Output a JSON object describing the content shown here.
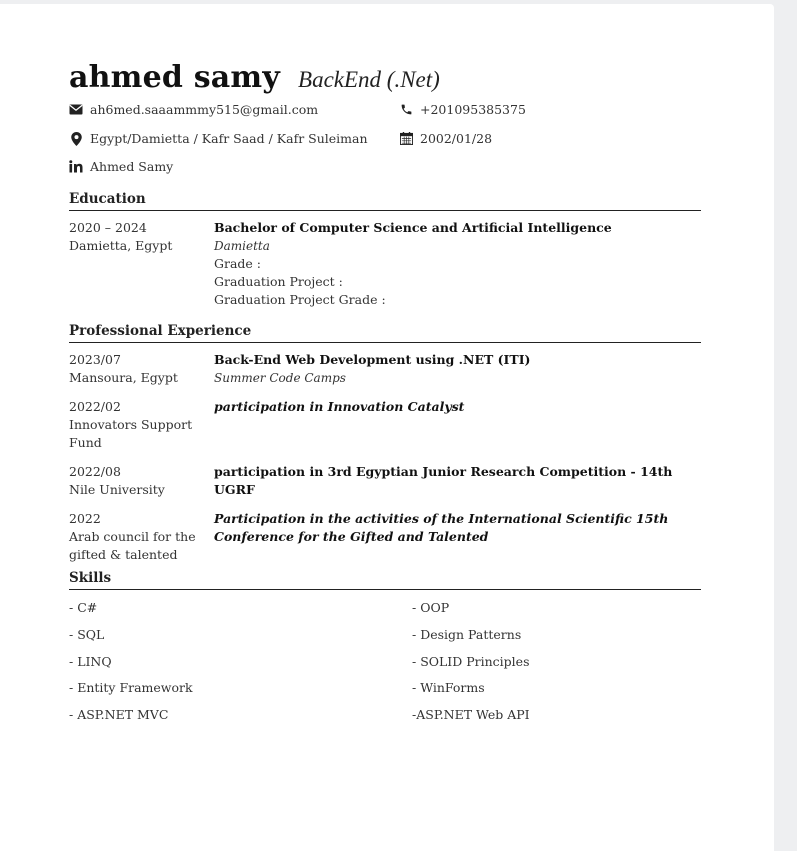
{
  "header": {
    "name": "ahmed samy",
    "role": "BackEnd (.Net)"
  },
  "contacts": {
    "email": "ah6med.saaammmy515@gmail.com",
    "phone": "+201095385375",
    "location": "Egypt/Damietta /  Kafr Saad / Kafr Suleiman",
    "birthdate": "2002/01/28",
    "linkedin": "Ahmed Samy"
  },
  "education": {
    "title": "Education",
    "entries": [
      {
        "date": "2020 – 2024",
        "place": "Damietta, Egypt",
        "degree": "Bachelor of Computer Science and Artificial Intelligence",
        "institution": "Damietta",
        "grade": "Grade :",
        "project": "Graduation Project :",
        "project_grade": "Graduation Project Grade :"
      }
    ]
  },
  "experience": {
    "title": "Professional Experience",
    "entries": [
      {
        "date": "2023/07",
        "place": "Mansoura, Egypt",
        "title": "Back-End Web Development using .NET (ITI)",
        "sub": "Summer Code Camps"
      },
      {
        "date": "2022/02",
        "place": "Innovators Support Fund",
        "title": "participation in Innovation Catalyst"
      },
      {
        "date": "2022/08",
        "place": "Nile University",
        "title": "participation in 3rd Egyptian Junior Research Competition - 14th UGRF"
      },
      {
        "date": "2022",
        "place": "Arab council for the gifted & talented",
        "title": "Participation in the activities of the International Scientific 15th Conference for the Gifted and Talented"
      }
    ]
  },
  "skills": {
    "title": "Skills",
    "items": [
      "- C#",
      "- OOP",
      "- SQL",
      "- Design Patterns",
      "- LINQ",
      "- SOLID Principles",
      "- Entity Framework",
      "- WinForms",
      "- ASP.NET MVC",
      "-ASP.NET Web API"
    ]
  },
  "icons": {
    "email": "envelope-icon",
    "phone": "phone-icon",
    "location": "map-pin-icon",
    "birthdate": "calendar-icon",
    "linkedin": "linkedin-icon"
  }
}
